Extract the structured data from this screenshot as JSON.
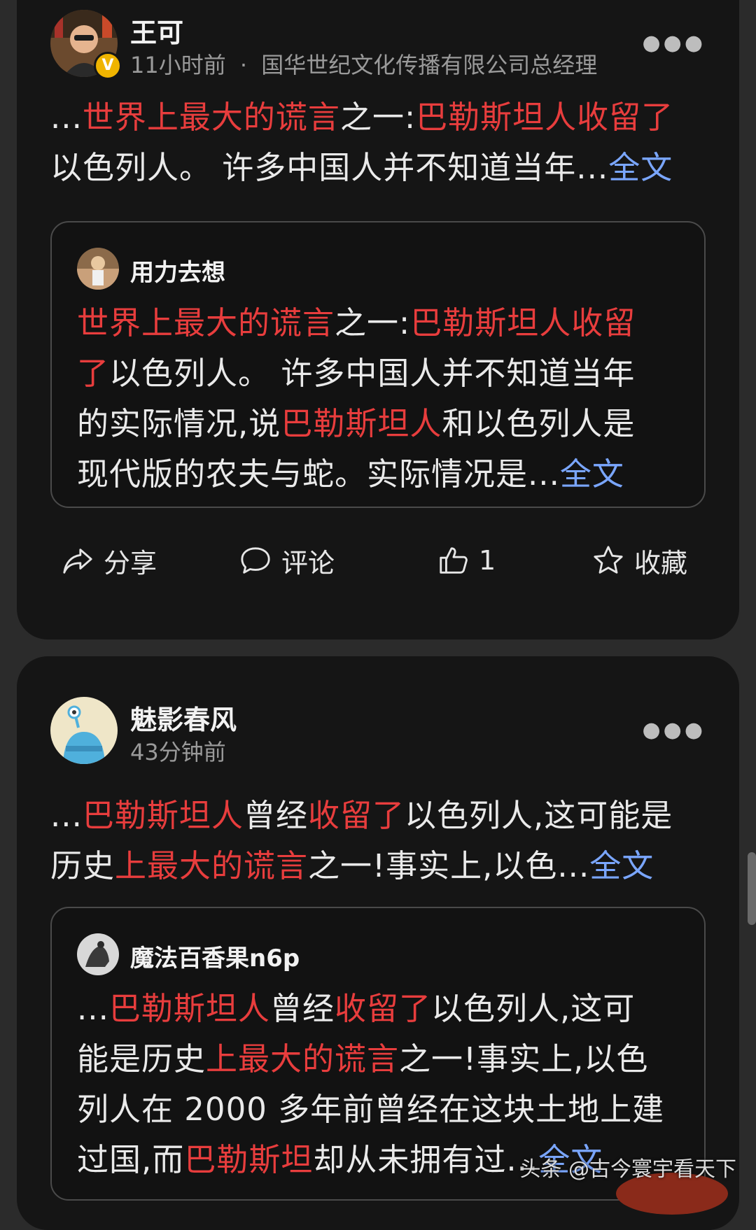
{
  "posts": [
    {
      "author": "王可",
      "verified_badge": "V",
      "time": "11小时前",
      "meta_separator": "·",
      "bio": "国华世纪文化传播有限公司总经理",
      "more_icon": "more-dots-icon",
      "text": {
        "prefix": "...",
        "hl1": "世界上最大的谎言",
        "t1": "之一:",
        "hl2": "巴勒斯坦人收留了",
        "t2": "以色列人。 许多中国人并不知道当年...",
        "more": "全文"
      },
      "quote": {
        "author": "用力去想",
        "line1_hl1": "世界上最大的谎言",
        "line1_t1": "之一:",
        "line1_hl2": "巴勒斯坦人收留",
        "line2_hl": "了",
        "line2_t": "以色列人。 许多中国人并不知道当年",
        "line3_t1": "的实际情况,说",
        "line3_hl": "巴勒斯坦人",
        "line3_t2": "和以色列人是",
        "line4_t": "现代版的农夫与蛇。实际情况是...",
        "more": "全文"
      },
      "actions": {
        "share": "分享",
        "comment": "评论",
        "like_count": "1",
        "favorite": "收藏"
      }
    },
    {
      "author": "魅影春风",
      "time": "43分钟前",
      "more_icon": "more-dots-icon",
      "text": {
        "prefix": "...",
        "hl1": "巴勒斯坦人",
        "t1": "曾经",
        "hl2": "收留了",
        "t2": "以色列人,这可能是",
        "line2_t1": "历史",
        "line2_hl": "上最大的谎言",
        "line2_t2": "之一!事实上,以色...",
        "more": "全文"
      },
      "quote": {
        "author": "魔法百香果n6p",
        "line1_prefix": "...",
        "line1_hl1": "巴勒斯坦人",
        "line1_t1": "曾经",
        "line1_hl2": "收留了",
        "line1_t2": "以色列人,这可",
        "line2_t1": "能是历史",
        "line2_hl": "上最大的谎言",
        "line2_t2": "之一!事实上,以色",
        "line3_t": "列人在 2000 多年前曾经在这块土地上建",
        "line4_t1": "过国,而",
        "line4_hl": "巴勒斯坦",
        "line4_t2": "却从未拥有过",
        "line4_t3": "...",
        "more": "全文"
      }
    }
  ],
  "watermark": "头条 @古今寰宇看天下"
}
